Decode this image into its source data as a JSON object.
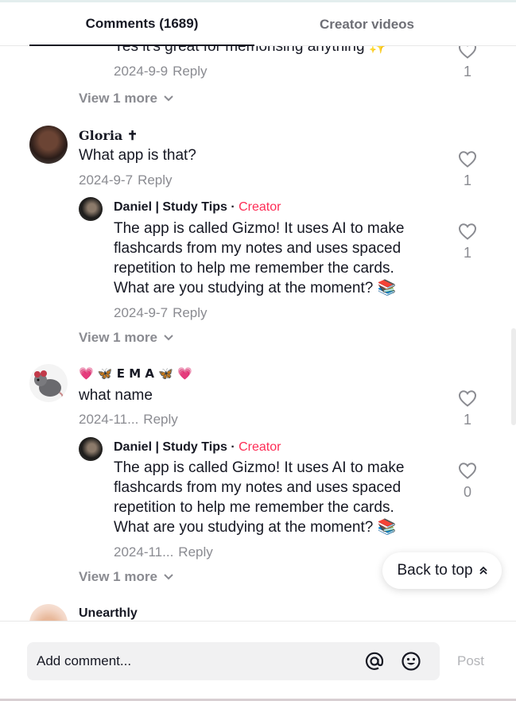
{
  "tabs": {
    "comments": "Comments (1689)",
    "creator_videos": "Creator videos"
  },
  "comments": [
    {
      "cut_text": "Yes it's great for memorising anything ✨",
      "date": "2024-9-9",
      "reply_label": "Reply",
      "likes": "1",
      "view_more": "View 1 more"
    },
    {
      "username": "Gloria ✝",
      "text": "What app is that?",
      "date": "2024-9-7",
      "reply_label": "Reply",
      "likes": "1",
      "reply": {
        "username": "Daniel | Study Tips",
        "separator": "·",
        "creator_badge": "Creator",
        "text": "The app is called Gizmo! It uses AI to make flashcards from my notes and uses spaced repetition to help me remember the cards. What are you studying at the moment? 📚",
        "date": "2024-9-7",
        "reply_label": "Reply",
        "likes": "1"
      },
      "view_more": "View 1 more"
    },
    {
      "username": "💗 🦋 E M A 🦋 💗",
      "text": "what name",
      "date": "2024-11...",
      "reply_label": "Reply",
      "likes": "1",
      "reply": {
        "username": "Daniel | Study Tips",
        "separator": "·",
        "creator_badge": "Creator",
        "text": "The app is called Gizmo! It uses AI to make flashcards from my notes and uses spaced repetition to help me remember the cards. What are you studying at the moment? 📚",
        "date": "2024-11...",
        "reply_label": "Reply",
        "likes": "0"
      },
      "view_more": "View 1 more"
    },
    {
      "username": "Unearthly"
    }
  ],
  "back_to_top": "Back to top",
  "footer": {
    "placeholder": "Add comment...",
    "post_label": "Post"
  },
  "icons": {
    "like": "heart-outline-icon",
    "chevron": "chevron-down-icon",
    "mention": "at-sign-icon",
    "emoji": "emoji-icon",
    "back_top": "double-chevron-up-icon"
  },
  "colors": {
    "creator": "#fe2c55",
    "meta": "#8a8b91",
    "text": "#161823",
    "input_bg": "#f1f1f2"
  }
}
